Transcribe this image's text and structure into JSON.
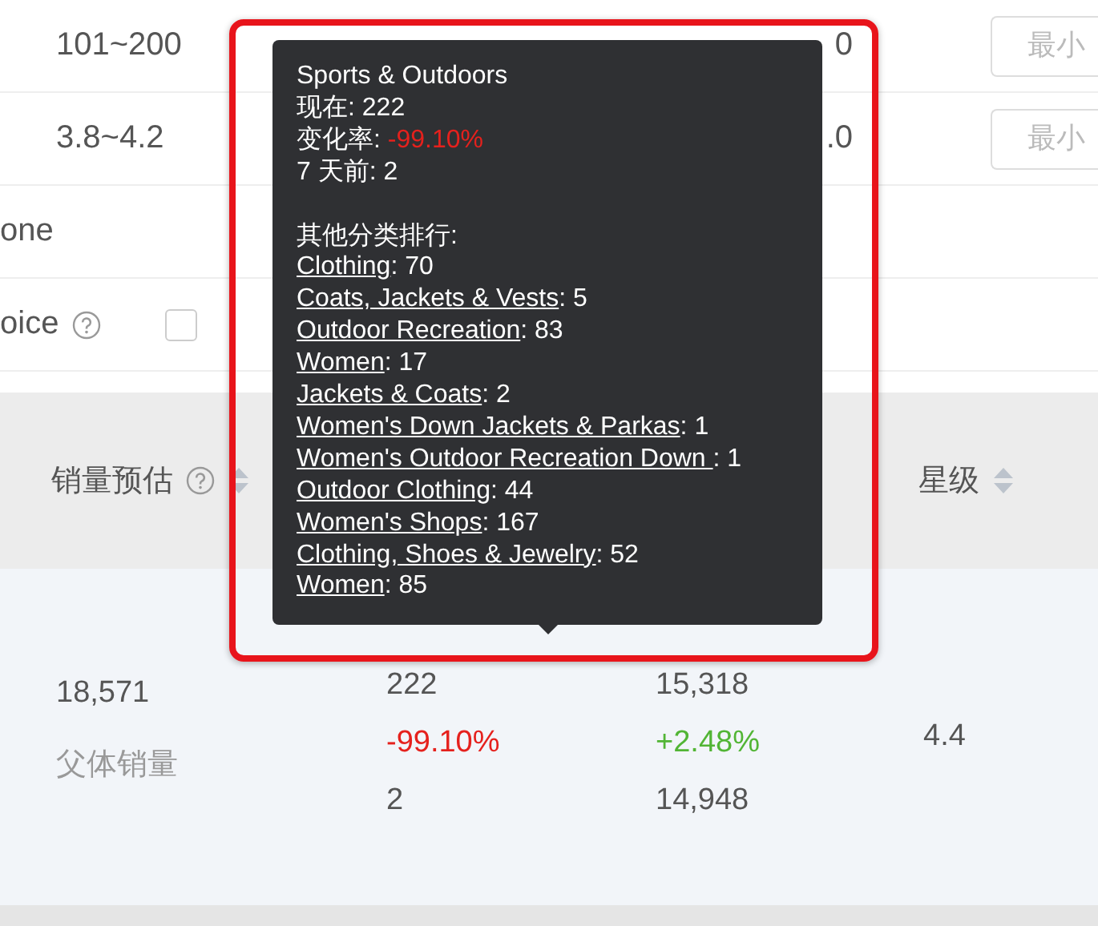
{
  "filters": [
    {
      "options": [
        "101~200"
      ],
      "last_option": "0",
      "min_field": {
        "placeholder": "最小"
      }
    },
    {
      "options": [
        "3.8~4.2"
      ],
      "last_option": ".0",
      "min_field": {
        "placeholder": "最小"
      }
    },
    {
      "label": "one"
    },
    {
      "label": "oice",
      "help": true,
      "checkbox": {
        "checked": false
      }
    }
  ],
  "table": {
    "columns": [
      {
        "label": "销量预估",
        "help": true,
        "sortable": true
      },
      {
        "label": "星级",
        "sortable": true
      }
    ],
    "row": {
      "sales": {
        "value": "18,571",
        "note": "父体销量"
      },
      "rank_now": [
        {
          "text": "222",
          "kind": "plain"
        },
        {
          "text": "-99.10%",
          "kind": "down"
        },
        {
          "text": "2",
          "kind": "plain"
        }
      ],
      "rank_main": [
        {
          "text": "15,318",
          "kind": "plain"
        },
        {
          "text": "+2.48%",
          "kind": "up"
        },
        {
          "text": "14,948",
          "kind": "plain"
        }
      ],
      "stars": "4.4"
    }
  },
  "tooltip": {
    "title": "Sports & Outdoors",
    "lines": [
      {
        "label": "现在:",
        "value": "222",
        "kind": "plain"
      },
      {
        "label": "变化率:",
        "value": "-99.10%",
        "kind": "down"
      },
      {
        "label": "7 天前:",
        "value": "2",
        "kind": "plain"
      }
    ],
    "ranking_heading": "其他分类排行:",
    "rankings": [
      {
        "category": "Clothing",
        "rest": ": 70"
      },
      {
        "category": "Coats, Jackets & Vests",
        "rest": ": 5"
      },
      {
        "category": "Outdoor Recreation",
        "rest": ": 83"
      },
      {
        "category": "Women",
        "rest": ": 17"
      },
      {
        "category": "Jackets & Coats",
        "rest": ": 2"
      },
      {
        "category": "Women's Down Jackets & Parkas",
        "rest": ": 1"
      },
      {
        "category": "Women's Outdoor Recreation Down ",
        "rest": ": 1"
      },
      {
        "category": "Outdoor Clothing",
        "rest": ": 44"
      },
      {
        "category": "Women's Shops",
        "rest": ": 167"
      },
      {
        "category": "Clothing, Shoes & Jewelry",
        "rest": ": 52"
      },
      {
        "category": "Women",
        "rest": ": 85"
      }
    ]
  },
  "highlight": {
    "shown": true
  }
}
